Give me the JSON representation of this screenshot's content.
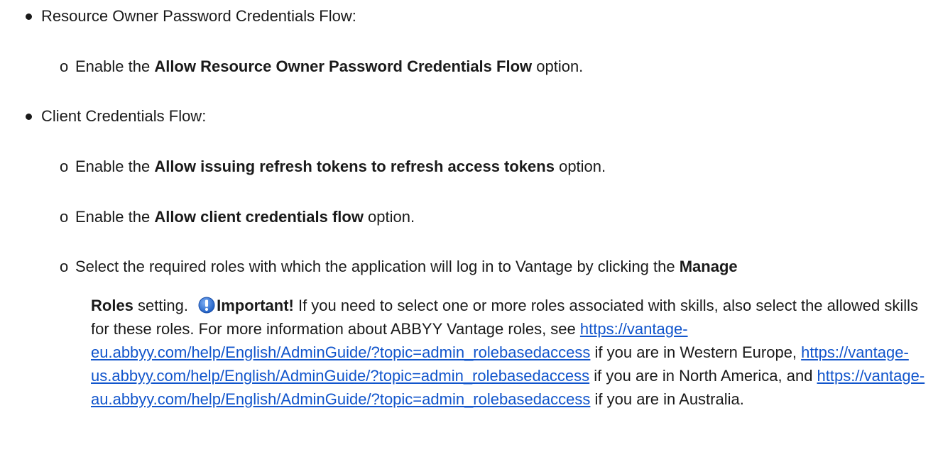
{
  "items": [
    {
      "label": "Resource Owner Password Credentials Flow:",
      "subitems": [
        {
          "prefix": "Enable the ",
          "bold": "Allow Resource Owner Password Credentials Flow",
          "suffix": " option."
        }
      ]
    },
    {
      "label": "Client Credentials Flow:",
      "subitems": [
        {
          "prefix": "Enable the ",
          "bold": "Allow issuing refresh tokens to refresh access tokens",
          "suffix": " option."
        },
        {
          "prefix": "Enable the ",
          "bold": "Allow client credentials flow",
          "suffix": " option."
        },
        {
          "prefix": "Select the required roles with which the application will log in to Vantage by clicking the ",
          "bold": "Manage",
          "bold2": "Roles",
          "mid": " setting. ",
          "important_label": "Important!",
          "important_text": " If you need to select one or more roles associated with skills, also select the allowed skills for these roles. For more information about ABBYY Vantage roles, see ",
          "link_eu": "https://vantage-eu.abbyy.com/help/English/AdminGuide/?topic=admin_rolebasedaccess",
          "text_eu": " if you are in Western Europe, ",
          "link_us": "https://vantage-us.abbyy.com/help/English/AdminGuide/?topic=admin_rolebasedaccess",
          "text_us": " if you are in North America, and ",
          "link_au": "https://vantage-au.abbyy.com/help/English/AdminGuide/?topic=admin_rolebasedaccess",
          "text_au": " if you are in Australia."
        }
      ]
    }
  ],
  "colors": {
    "text": "#1a1a1a",
    "link": "#1155cc",
    "icon": "#2f6fd6"
  },
  "icon": "info-icon"
}
